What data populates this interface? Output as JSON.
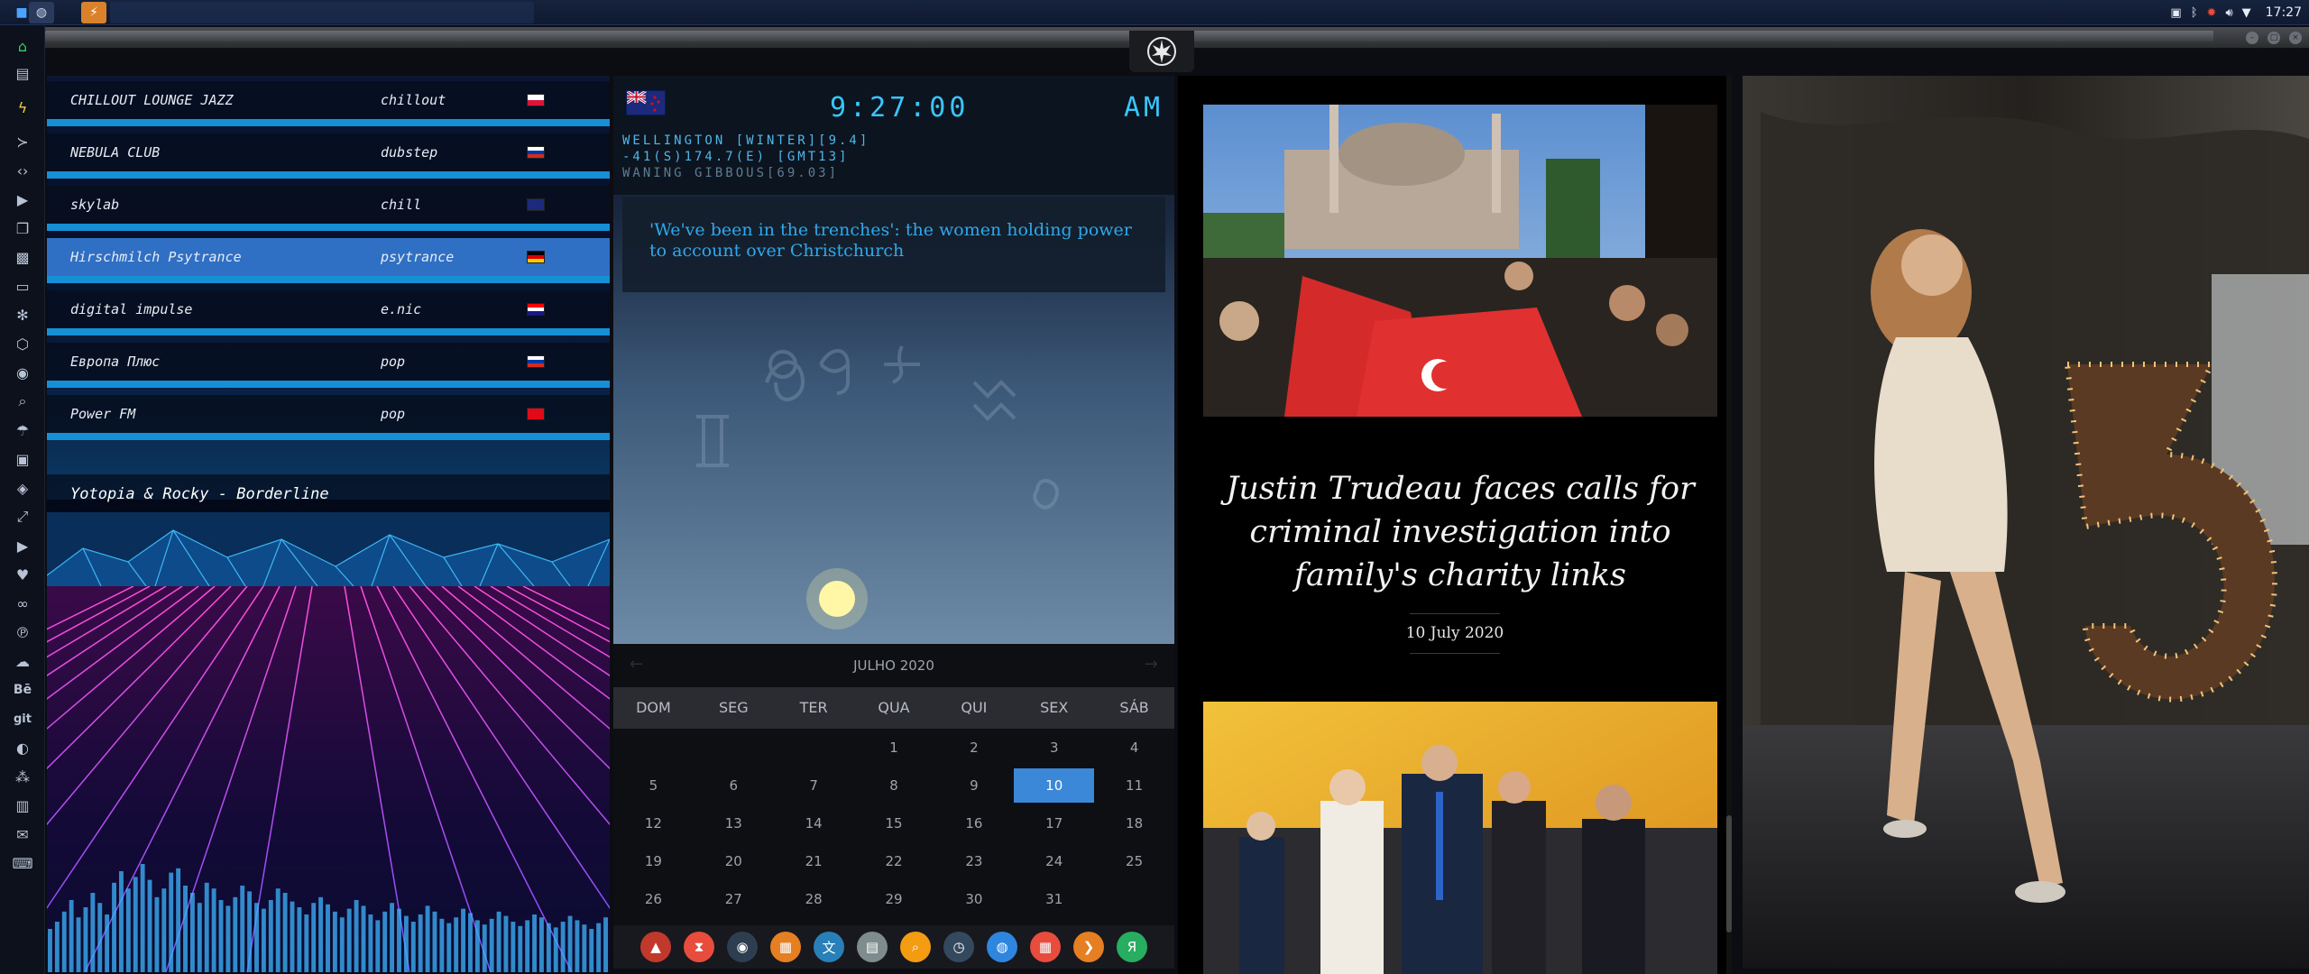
{
  "system": {
    "clock": "17:27",
    "tray_icons": [
      "screenshot-icon",
      "bluetooth-icon",
      "settings-icon",
      "volume-icon",
      "wifi-icon"
    ]
  },
  "radio": {
    "stations": [
      {
        "name": "CHILLOUT LOUNGE JAZZ",
        "genre": "chillout",
        "flag": "pl",
        "active": false
      },
      {
        "name": "NEBULA CLUB",
        "genre": "dubstep",
        "flag": "ru",
        "active": false
      },
      {
        "name": "skylab",
        "genre": "chill",
        "flag": "gb",
        "active": false
      },
      {
        "name": "Hirschmilch Psytrance",
        "genre": "psytrance",
        "flag": "de",
        "active": true
      },
      {
        "name": "digital impulse",
        "genre": "e.nic",
        "flag": "hr",
        "active": false
      },
      {
        "name": "Европа Плюс",
        "genre": "pop",
        "flag": "ru",
        "active": false
      },
      {
        "name": "Power FM",
        "genre": "pop",
        "flag": "tr",
        "active": false
      }
    ],
    "now_playing": "Yotopia & Rocky - Borderline",
    "eq_levels": [
      0.3,
      0.35,
      0.42,
      0.5,
      0.38,
      0.45,
      0.55,
      0.48,
      0.4,
      0.62,
      0.7,
      0.58,
      0.66,
      0.75,
      0.64,
      0.52,
      0.58,
      0.69,
      0.72,
      0.6,
      0.55,
      0.48,
      0.62,
      0.58,
      0.5,
      0.46,
      0.52,
      0.6,
      0.56,
      0.48,
      0.44,
      0.5,
      0.58,
      0.55,
      0.49,
      0.45,
      0.4,
      0.48,
      0.52,
      0.47,
      0.42,
      0.38,
      0.44,
      0.5,
      0.46,
      0.4,
      0.36,
      0.42,
      0.48,
      0.44,
      0.39,
      0.35,
      0.4,
      0.46,
      0.42,
      0.37,
      0.34,
      0.38,
      0.44,
      0.41,
      0.36,
      0.33,
      0.37,
      0.42,
      0.39,
      0.35,
      0.32,
      0.36,
      0.4,
      0.38,
      0.34,
      0.31,
      0.35,
      0.39,
      0.36,
      0.33,
      0.3,
      0.34,
      0.38
    ]
  },
  "clock_widget": {
    "time": "9:27:00",
    "ampm": "AM",
    "location": "WELLINGTON [WINTER][9.4]",
    "coords": "-41(S)174.7(E) [GMT13]",
    "moon": "WANING GIBBOUS[69.03]",
    "news": "'We've been in the trenches': the women holding power to account over Christchurch"
  },
  "calendar": {
    "month": "JULHO 2020",
    "prev": "←",
    "next": "→",
    "weekdays": [
      "DOM",
      "SEG",
      "TER",
      "QUA",
      "QUI",
      "SEX",
      "SÁB"
    ],
    "weeks": [
      [
        "",
        "",
        "",
        "1",
        "2",
        "3",
        "4"
      ],
      [
        "5",
        "6",
        "7",
        "8",
        "9",
        "10",
        "11"
      ],
      [
        "12",
        "13",
        "14",
        "15",
        "16",
        "17",
        "18"
      ],
      [
        "19",
        "20",
        "21",
        "22",
        "23",
        "24",
        "25"
      ],
      [
        "26",
        "27",
        "28",
        "29",
        "30",
        "31",
        ""
      ]
    ],
    "today": "10"
  },
  "launcher": {
    "items": [
      {
        "name": "app-red-icon",
        "color": "#c0392b"
      },
      {
        "name": "hourglass-icon",
        "color": "#e74c3c"
      },
      {
        "name": "system-monitor-icon",
        "color": "#2c3e50"
      },
      {
        "name": "image-viewer-icon",
        "color": "#e67e22"
      },
      {
        "name": "translator-icon",
        "color": "#2980b9"
      },
      {
        "name": "notes-icon",
        "color": "#7f8c8d"
      },
      {
        "name": "search-app-icon",
        "color": "#f39c12"
      },
      {
        "name": "clock-app-icon",
        "color": "#34495e"
      },
      {
        "name": "globe-icon",
        "color": "#2e86de"
      },
      {
        "name": "calendar-app-icon",
        "color": "#e74c3c"
      },
      {
        "name": "terminal-arrow-icon",
        "color": "#e67e22"
      },
      {
        "name": "yandex-icon",
        "color": "#27ae60"
      }
    ]
  },
  "news": {
    "headline": "Justin Trudeau faces calls for criminal investigation into family's charity links",
    "date": "10 July 2020"
  }
}
